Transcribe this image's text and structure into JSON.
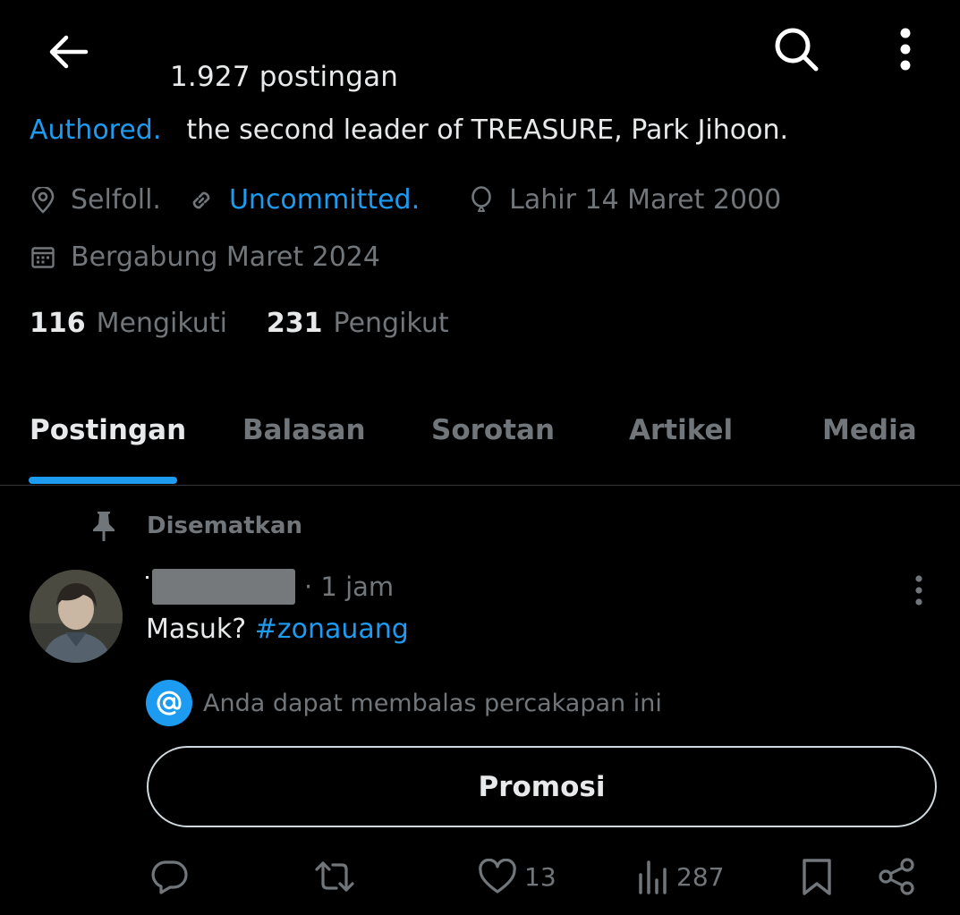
{
  "header": {
    "post_count": "1.927 postingan"
  },
  "bio": {
    "link_text": "Authored.",
    "text": "the second leader of TREASURE, Park Jihoon."
  },
  "meta": {
    "location": "Selfoll.",
    "website": "Uncommitted.",
    "birth": "Lahir 14 Maret 2000",
    "joined": "Bergabung Maret 2024"
  },
  "stats": {
    "following_count": "116",
    "following_label": "Mengikuti",
    "followers_count": "231",
    "followers_label": "Pengikut"
  },
  "tabs": [
    {
      "label": "Postingan",
      "active": true
    },
    {
      "label": "Balasan",
      "active": false
    },
    {
      "label": "Sorotan",
      "active": false
    },
    {
      "label": "Artikel",
      "active": false
    },
    {
      "label": "Media",
      "active": false
    }
  ],
  "pinned": {
    "label": "Disematkan"
  },
  "tweet": {
    "time": "· 1 jam",
    "text_prefix": "Masuk? ",
    "hashtag": "#zonauang",
    "reply_note": "Anda dapat membalas percakapan ini",
    "promo_label": "Promosi",
    "actions": {
      "likes": "13",
      "views": "287"
    }
  },
  "colors": {
    "background": "#000000",
    "accent": "#1d9bf0",
    "text_primary": "#e7e9ea",
    "text_secondary": "#71767b"
  },
  "icons": [
    "arrow-left-icon",
    "search-icon",
    "more-vertical-icon",
    "location-pin-icon",
    "link-icon",
    "balloon-icon",
    "calendar-icon",
    "pin-icon",
    "at-icon",
    "reply-icon",
    "retweet-icon",
    "heart-icon",
    "views-icon",
    "bookmark-icon",
    "share-icon"
  ]
}
